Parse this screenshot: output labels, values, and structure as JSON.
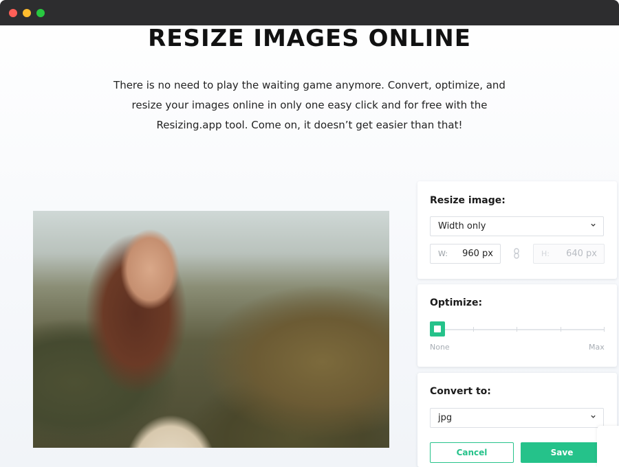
{
  "page": {
    "title": "RESIZE IMAGES ONLINE",
    "description": "There is no need to play the waiting game anymore. Convert, optimize, and resize your images online in only one easy click and for free with the Resizing.app tool. Come on, it doesn’t get easier than that!"
  },
  "resize": {
    "label": "Resize image:",
    "mode": "Width only",
    "width_prefix": "W:",
    "width_value": "960 px",
    "height_prefix": "H:",
    "height_value": "640 px"
  },
  "optimize": {
    "label": "Optimize:",
    "level_fraction": 0,
    "min_label": "None",
    "max_label": "Max"
  },
  "convert": {
    "label": "Convert to:",
    "format": "jpg"
  },
  "actions": {
    "cancel": "Cancel",
    "save": "Save"
  },
  "colors": {
    "accent": "#25c28a",
    "titlebar": "#2d2d2f"
  },
  "icons": {
    "mode_dropdown": "chevron-down-icon",
    "format_dropdown": "chevron-down-icon",
    "aspect_lock": "link-icon"
  }
}
